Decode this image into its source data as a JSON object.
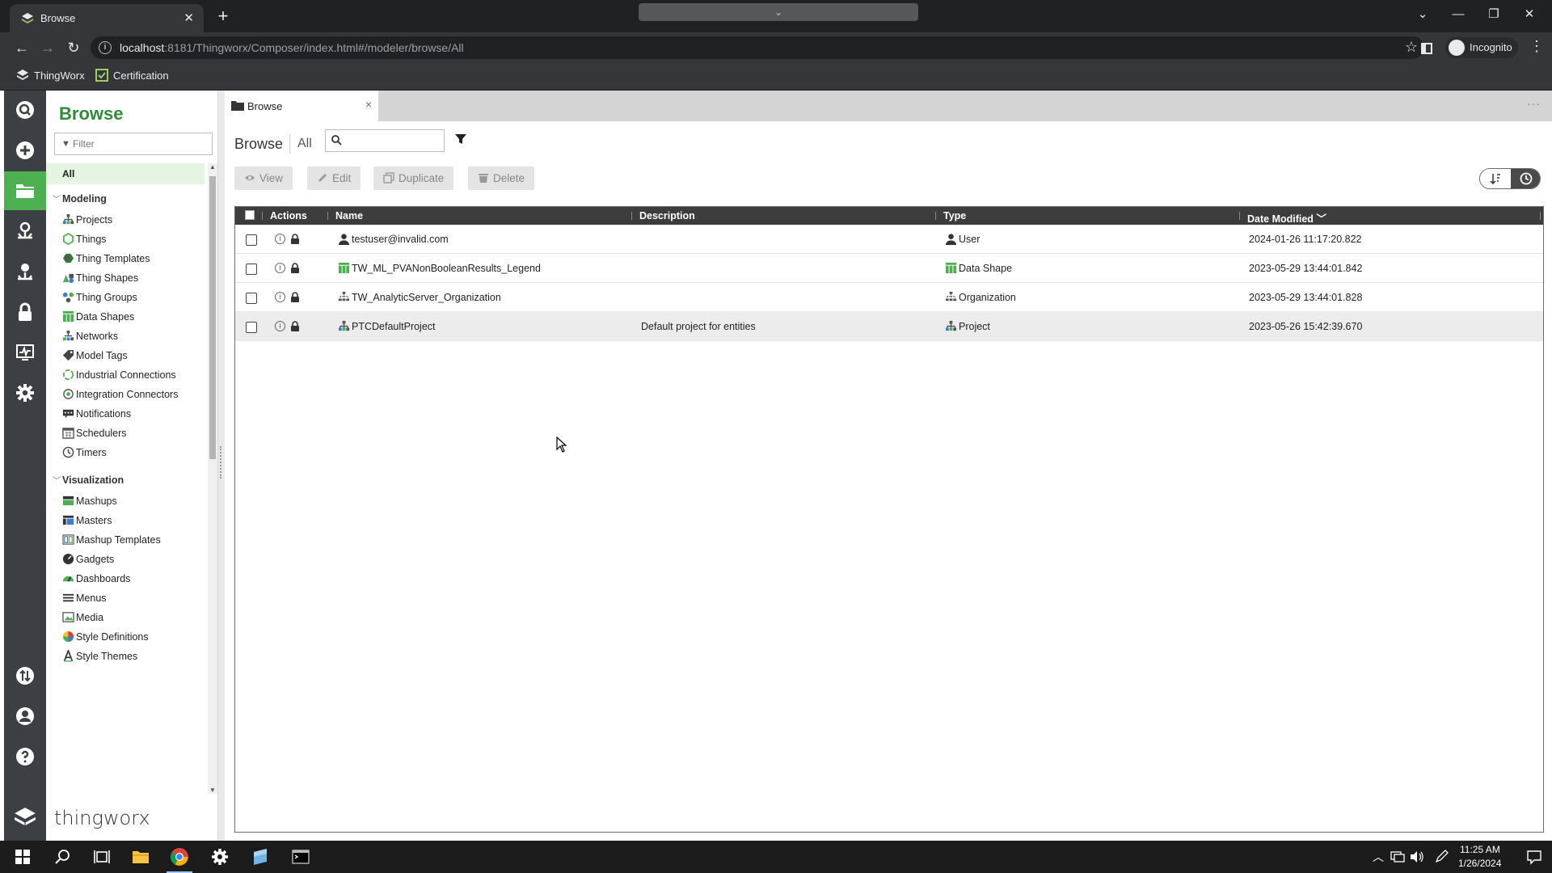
{
  "browser": {
    "tab_title": "Browse",
    "new_tab": "+",
    "url_host": "localhost",
    "url_rest": ":8181/Thingworx/Composer/index.html#/modeler/browse/All",
    "incognito_label": "Incognito",
    "bookmarks": [
      "ThingWorx",
      "Certification"
    ]
  },
  "rail": {
    "items": [
      "search-icon",
      "add-icon",
      "folder-icon",
      "network-icon",
      "organization-icon",
      "lock-icon",
      "monitor-icon",
      "gear-icon",
      "import-export-icon",
      "user-icon",
      "help-icon"
    ],
    "active": "folder-icon"
  },
  "left_panel": {
    "title": "Browse",
    "filter_placeholder": "Filter",
    "all_label": "All",
    "sections": [
      {
        "label": "Modeling",
        "items": [
          "Projects",
          "Things",
          "Thing Templates",
          "Thing Shapes",
          "Thing Groups",
          "Data Shapes",
          "Networks",
          "Model Tags",
          "Industrial Connections",
          "Integration Connectors",
          "Notifications",
          "Schedulers",
          "Timers"
        ]
      },
      {
        "label": "Visualization",
        "items": [
          "Mashups",
          "Masters",
          "Mashup Templates",
          "Gadgets",
          "Dashboards",
          "Menus",
          "Media",
          "Style Definitions",
          "Style Themes"
        ]
      }
    ],
    "brand": "thingworx"
  },
  "workspace": {
    "tab_title": "Browse",
    "tab_close": "×",
    "more": "···",
    "crumb_main": "Browse",
    "crumb_sub": "All",
    "search_value": "",
    "buttons": {
      "view": "View",
      "edit": "Edit",
      "duplicate": "Duplicate",
      "delete": "Delete"
    }
  },
  "grid": {
    "columns": {
      "actions": "Actions",
      "name": "Name",
      "description": "Description",
      "type": "Type",
      "date_modified": "Date Modified"
    },
    "sort_column": "Date Modified",
    "sort_direction": "descending",
    "rows": [
      {
        "name": "testuser@invalid.com",
        "description": "",
        "type": "User",
        "date": "2024-01-26 11:17:20.822",
        "icon": "user-icon"
      },
      {
        "name": "TW_ML_PVANonBooleanResults_Legend",
        "description": "",
        "type": "Data Shape",
        "date": "2023-05-29 13:44:01.842",
        "icon": "data-shape-icon"
      },
      {
        "name": "TW_AnalyticServer_Organization",
        "description": "",
        "type": "Organization",
        "date": "2023-05-29 13:44:01.828",
        "icon": "organization-icon"
      },
      {
        "name": "PTCDefaultProject",
        "description": "Default project for entities",
        "type": "Project",
        "date": "2023-05-26 15:42:39.670",
        "icon": "project-icon"
      }
    ]
  },
  "taskbar": {
    "time": "11:25 AM",
    "date": "1/26/2024"
  },
  "colors": {
    "accent": "#4caf50",
    "brand_green": "#2e8b3a",
    "grid_header": "#3d3d3d",
    "rail": "#3c3f43"
  }
}
